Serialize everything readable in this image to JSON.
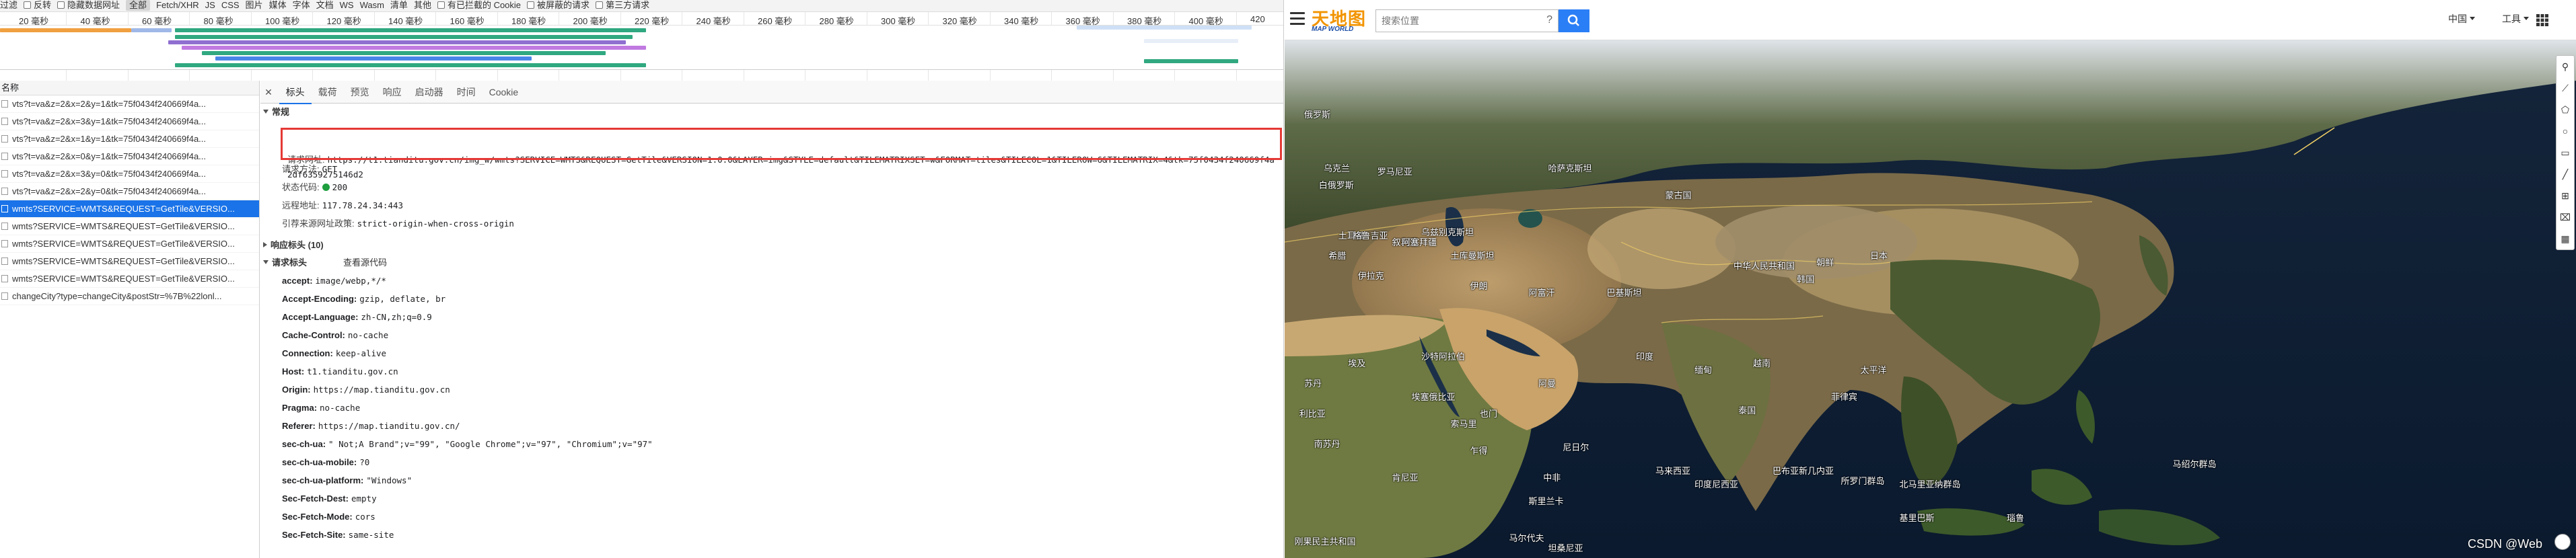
{
  "devtools": {
    "filterbar": {
      "items": [
        "过滤",
        "反转",
        "隐藏数据网址",
        "全部",
        "Fetch/XHR",
        "JS",
        "CSS",
        "图片",
        "媒体",
        "字体",
        "文档",
        "WS",
        "Wasm",
        "清单",
        "其他",
        "有已拦截的 Cookie",
        "被屏蔽的请求",
        "第三方请求"
      ]
    },
    "ruler_ticks": [
      "20 毫秒",
      "40 毫秒",
      "60 毫秒",
      "80 毫秒",
      "100 毫秒",
      "120 毫秒",
      "140 毫秒",
      "160 毫秒",
      "180 毫秒",
      "200 毫秒",
      "220 毫秒",
      "240 毫秒",
      "260 毫秒",
      "280 毫秒",
      "300 毫秒",
      "320 毫秒",
      "340 毫秒",
      "360 毫秒",
      "380 毫秒",
      "400 毫秒",
      "420"
    ],
    "requests": {
      "column_header": "名称",
      "rows": [
        "vts?t=va&z=2&x=2&y=1&tk=75f0434f240669f4a...",
        "vts?t=va&z=2&x=3&y=1&tk=75f0434f240669f4a...",
        "vts?t=va&z=2&x=1&y=1&tk=75f0434f240669f4a...",
        "vts?t=va&z=2&x=0&y=1&tk=75f0434f240669f4a...",
        "vts?t=va&z=2&x=3&y=0&tk=75f0434f240669f4a...",
        "vts?t=va&z=2&x=2&y=0&tk=75f0434f240669f4a...",
        "wmts?SERVICE=WMTS&REQUEST=GetTile&VERSIO...",
        "wmts?SERVICE=WMTS&REQUEST=GetTile&VERSIO...",
        "wmts?SERVICE=WMTS&REQUEST=GetTile&VERSIO...",
        "wmts?SERVICE=WMTS&REQUEST=GetTile&VERSIO...",
        "wmts?SERVICE=WMTS&REQUEST=GetTile&VERSIO...",
        "changeCity?type=changeCity&postStr=%7B%22lonl..."
      ]
    },
    "tabs": [
      "标头",
      "载荷",
      "预览",
      "响应",
      "启动器",
      "时间",
      "Cookie"
    ],
    "general": {
      "title": "常规",
      "url_label": "请求网址:",
      "url_value": "https://t1.tianditu.gov.cn/img_w/wmts?SERVICE=WMTS&REQUEST=GetTile&VERSION=1.0.0&LAYER=img&STYLE=default&TILEMATRIXSET=w&FORMAT=tiles&TILECOL=1&TILEROW=6&TILEMATRIX=4&tk=75f0434f240669f4a2df6359275146d2",
      "method_label": "请求方法:",
      "method_value": "GET",
      "status_label": "状态代码:",
      "status_value": "200",
      "remote_label": "远程地址:",
      "remote_value": "117.78.24.34:443",
      "referrer_label": "引荐来源网址政策:",
      "referrer_value": "strict-origin-when-cross-origin"
    },
    "response_headers": {
      "title": "响应标头 (10)"
    },
    "request_headers": {
      "title": "请求标头",
      "view_source": "查看源代码",
      "items": [
        {
          "k": "accept:",
          "v": "image/webp,*/*"
        },
        {
          "k": "Accept-Encoding:",
          "v": "gzip, deflate, br"
        },
        {
          "k": "Accept-Language:",
          "v": "zh-CN,zh;q=0.9"
        },
        {
          "k": "Cache-Control:",
          "v": "no-cache"
        },
        {
          "k": "Connection:",
          "v": "keep-alive"
        },
        {
          "k": "Host:",
          "v": "t1.tianditu.gov.cn"
        },
        {
          "k": "Origin:",
          "v": "https://map.tianditu.gov.cn"
        },
        {
          "k": "Pragma:",
          "v": "no-cache"
        },
        {
          "k": "Referer:",
          "v": "https://map.tianditu.gov.cn/"
        },
        {
          "k": "sec-ch-ua:",
          "v": "\" Not;A Brand\";v=\"99\", \"Google Chrome\";v=\"97\", \"Chromium\";v=\"97\""
        },
        {
          "k": "sec-ch-ua-mobile:",
          "v": "?0"
        },
        {
          "k": "sec-ch-ua-platform:",
          "v": "\"Windows\""
        },
        {
          "k": "Sec-Fetch-Dest:",
          "v": "empty"
        },
        {
          "k": "Sec-Fetch-Mode:",
          "v": "cors"
        },
        {
          "k": "Sec-Fetch-Site:",
          "v": "same-site"
        }
      ]
    }
  },
  "map": {
    "logo_cn": "天地图",
    "logo_en": "MAP WORLD",
    "search_placeholder": "搜索位置",
    "region": "中国",
    "tools": "工具",
    "labels": [
      "俄罗斯",
      "乌克兰",
      "白俄罗斯",
      "罗马尼亚",
      "土耳其",
      "哈萨克斯坦",
      "蒙古国",
      "中华人民共和国",
      "朝鲜",
      "日本",
      "韩国",
      "乌兹别克斯坦",
      "土库曼斯坦",
      "伊朗",
      "伊拉克",
      "叙利亚",
      "阿富汗",
      "巴基斯坦",
      "沙特阿拉伯",
      "埃及",
      "印度",
      "也门",
      "阿曼",
      "苏丹",
      "南苏丹",
      "埃塞俄比亚",
      "索马里",
      "肯尼亚",
      "缅甸",
      "泰国",
      "越南",
      "菲律宾",
      "马来西亚",
      "印度尼西亚",
      "巴布亚新几内亚",
      "所罗门群岛",
      "斯里兰卡",
      "马尔代夫",
      "北马里亚纳群岛",
      "马绍尔群岛",
      "瑙鲁",
      "基里巴斯",
      "格鲁吉亚",
      "阿塞拜疆",
      "太平洋",
      "利比亚",
      "希腊",
      "尼日尔",
      "乍得",
      "中非",
      "刚果民主共和国",
      "坦桑尼亚"
    ],
    "watermark": "CSDN @Web"
  }
}
